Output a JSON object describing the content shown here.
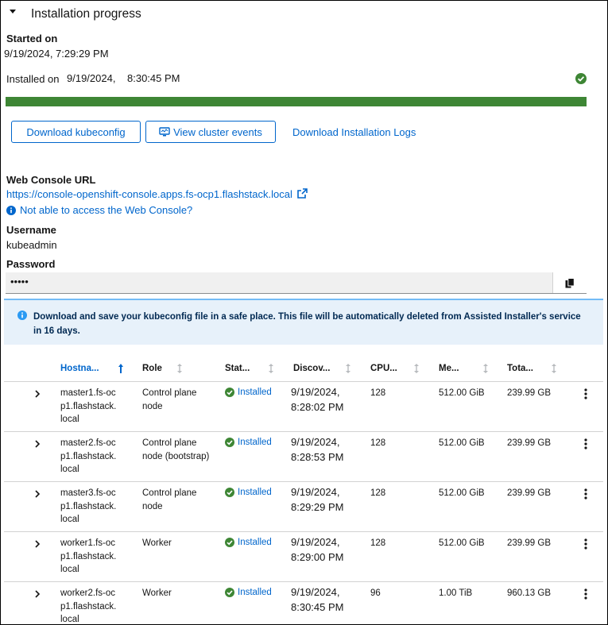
{
  "section": {
    "title": "Installation progress"
  },
  "started": {
    "label": "Started on",
    "value": "9/19/2024,  7:29:29 PM"
  },
  "installed": {
    "label": "Installed on",
    "date": "9/19/2024,",
    "time": "8:30:45 PM"
  },
  "progress": {
    "percent": 100,
    "color": "#3e8635"
  },
  "actions": {
    "download_kubeconfig": "Download kubeconfig",
    "view_events": "View cluster events",
    "download_logs": "Download Installation Logs"
  },
  "console": {
    "label": "Web Console URL",
    "url": "https://console-openshift-console.apps.fs-ocp1.flashstack.local",
    "help": "Not able to access the Web Console?"
  },
  "username": {
    "label": "Username",
    "value": "kubeadmin"
  },
  "password": {
    "label": "Password",
    "masked": "•••••"
  },
  "alert": {
    "text": "Download and save your kubeconfig file in a safe place. This file will be automatically deleted from Assisted Installer's service in 16 days."
  },
  "table": {
    "headers": [
      "Hostna...",
      "Role",
      "Stat...",
      "Discov...",
      "CPU...",
      "Me...",
      "Tota..."
    ],
    "rows": [
      {
        "host": "master1.fs-ocp1.flashstack.local",
        "role": "Control plane node",
        "status": "Installed",
        "discovered": "9/19/2024, 8:28:02 PM",
        "cpu": "128",
        "memory": "512.00 GiB",
        "total": "239.99 GB"
      },
      {
        "host": "master2.fs-ocp1.flashstack.local",
        "role": "Control plane node (bootstrap)",
        "status": "Installed",
        "discovered": "9/19/2024, 8:28:53 PM",
        "cpu": "128",
        "memory": "512.00 GiB",
        "total": "239.99 GB"
      },
      {
        "host": "master3.fs-ocp1.flashstack.local",
        "role": "Control plane node",
        "status": "Installed",
        "discovered": "9/19/2024, 8:29:29 PM",
        "cpu": "128",
        "memory": "512.00 GiB",
        "total": "239.99 GB"
      },
      {
        "host": "worker1.fs-ocp1.flashstack.local",
        "role": "Worker",
        "status": "Installed",
        "discovered": "9/19/2024, 8:29:00 PM",
        "cpu": "128",
        "memory": "512.00 GiB",
        "total": "239.99 GB"
      },
      {
        "host": "worker2.fs-ocp1.flashstack.local",
        "role": "Worker",
        "status": "Installed",
        "discovered": "9/19/2024, 8:30:45 PM",
        "cpu": "96",
        "memory": "1.00 TiB",
        "total": "960.13 GB"
      }
    ]
  },
  "colors": {
    "link": "#0066cc",
    "success": "#3e8635",
    "info": "#2b9af3"
  }
}
